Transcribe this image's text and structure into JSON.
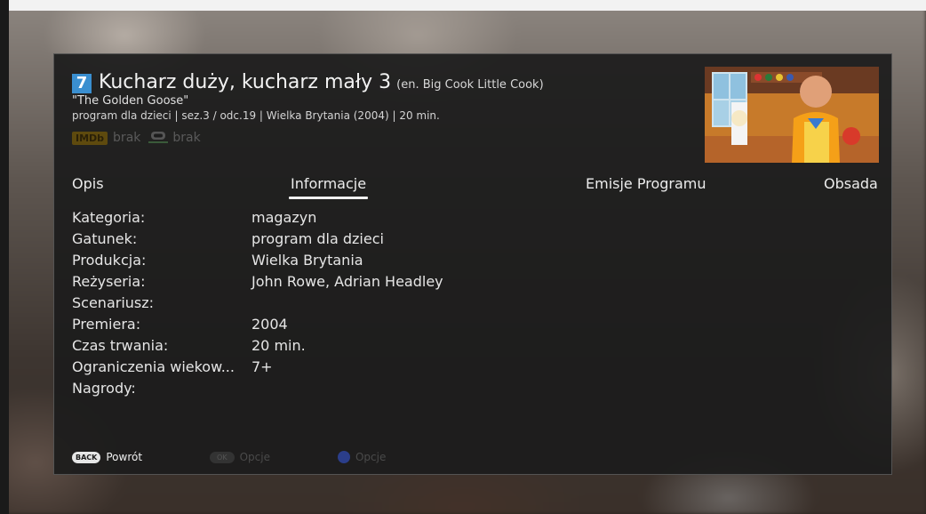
{
  "program": {
    "channel_number": "7",
    "title": "Kucharz duży, kucharz mały 3",
    "title_en": "(en. Big Cook Little Cook)",
    "episode_title": "\"The Golden Goose\"",
    "meta": "program dla dzieci | sez.3 / odc.19 | Wielka Brytania (2004) | 20 min."
  },
  "ratings": {
    "imdb_logo": "IMDb",
    "imdb_value": "brak",
    "filmweb_icon": "speech-bubble-icon",
    "filmweb_value": "brak"
  },
  "tabs": [
    {
      "label": "Opis"
    },
    {
      "label": "Informacje"
    },
    {
      "label": "Emisje Programu"
    },
    {
      "label": "Obsada"
    }
  ],
  "active_tab": "Informacje",
  "info": [
    {
      "label": "Kategoria:",
      "value": "magazyn"
    },
    {
      "label": "Gatunek:",
      "value": "program dla dzieci"
    },
    {
      "label": "Produkcja:",
      "value": "Wielka Brytania"
    },
    {
      "label": "Reżyseria:",
      "value": "John Rowe, Adrian Headley"
    },
    {
      "label": "Scenariusz:",
      "value": ""
    },
    {
      "label": "Premiera:",
      "value": "2004"
    },
    {
      "label": "Czas trwania:",
      "value": "20 min."
    },
    {
      "label": "Ograniczenia wiekow...",
      "value": "7+"
    },
    {
      "label": "Nagrody:",
      "value": ""
    }
  ],
  "footer": {
    "back_key": "BACK",
    "back_label": "Powrót",
    "ok_key": "OK",
    "ok_label": "Opcje",
    "blue_label": "Opcje"
  },
  "colors": {
    "accent_blue": "#3a8fd0",
    "blue_button": "#2b3e8a",
    "imdb_gold": "#5e4a0e"
  }
}
